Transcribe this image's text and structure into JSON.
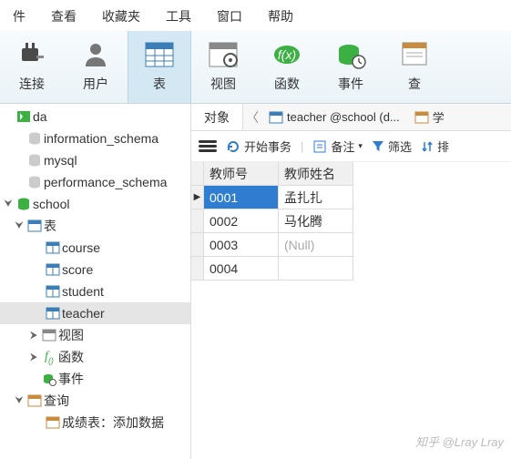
{
  "menu": {
    "file": "件",
    "view": "查看",
    "fav": "收藏夹",
    "tool": "工具",
    "window": "窗口",
    "help": "帮助"
  },
  "ribbon": {
    "conn": "连接",
    "user": "用户",
    "table": "表",
    "view": "视图",
    "func": "函数",
    "event": "事件",
    "query": "查"
  },
  "tree": {
    "da": "da",
    "info": "information_schema",
    "mysql": "mysql",
    "perf": "performance_schema",
    "school": "school",
    "tables": "表",
    "course": "course",
    "score": "score",
    "student": "student",
    "teacher": "teacher",
    "views": "视图",
    "funcs": "函数",
    "events": "事件",
    "queries": "查询",
    "q1": "成绩表：添加数据"
  },
  "tabs": {
    "obj": "对象",
    "teacher": "teacher @school (d...",
    "stu": "学"
  },
  "tools": {
    "begin": "开始事务",
    "note": "备注",
    "filter": "筛选",
    "sort": "排"
  },
  "headers": {
    "c1": "教师号",
    "c2": "教师姓名"
  },
  "rows": [
    {
      "id": "0001",
      "name": "孟扎扎"
    },
    {
      "id": "0002",
      "name": "马化腾"
    },
    {
      "id": "0003",
      "name": "(Null)"
    },
    {
      "id": "0004",
      "name": ""
    }
  ],
  "watermark": "知乎 @Lray Lray"
}
